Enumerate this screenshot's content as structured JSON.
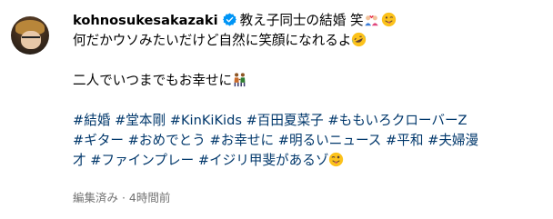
{
  "post": {
    "username": "kohnosukesakazaki",
    "caption_first": "教え子同士の結婚 笑",
    "line2": "何だかウソみたいだけど自然に笑顔になれるよ",
    "line3": "二人でいつまでもお幸せに",
    "hashtags": {
      "l1": [
        {
          "label": "#結婚"
        },
        {
          "label": "#堂本剛"
        },
        {
          "label": "#KinKiKids"
        },
        {
          "label": "#百田夏菜子"
        },
        {
          "label": "#ももいろクローバーZ"
        }
      ],
      "l2": [
        {
          "label": "#ギター"
        },
        {
          "label": "#おめでとう"
        },
        {
          "label": "#お幸せに"
        },
        {
          "label": "#明るいニュース"
        },
        {
          "label": "#平和"
        },
        {
          "label": "#夫婦漫"
        }
      ],
      "l3": [
        {
          "label": "才"
        },
        {
          "label": "#ファインプレー"
        },
        {
          "label": "#イジリ甲斐があるゾ"
        }
      ]
    },
    "meta": "編集済み · 4時間前"
  },
  "icons": {
    "verified": "verified-badge-icon",
    "couple": "couple-with-heart-emoji",
    "wink": "winking-tongue-face-emoji",
    "rofl": "rolling-on-floor-laughing-emoji",
    "people": "two-people-holding-hands-emoji"
  },
  "colors": {
    "hashtag": "#00376b",
    "meta": "#737373",
    "verified": "#0095f6"
  }
}
